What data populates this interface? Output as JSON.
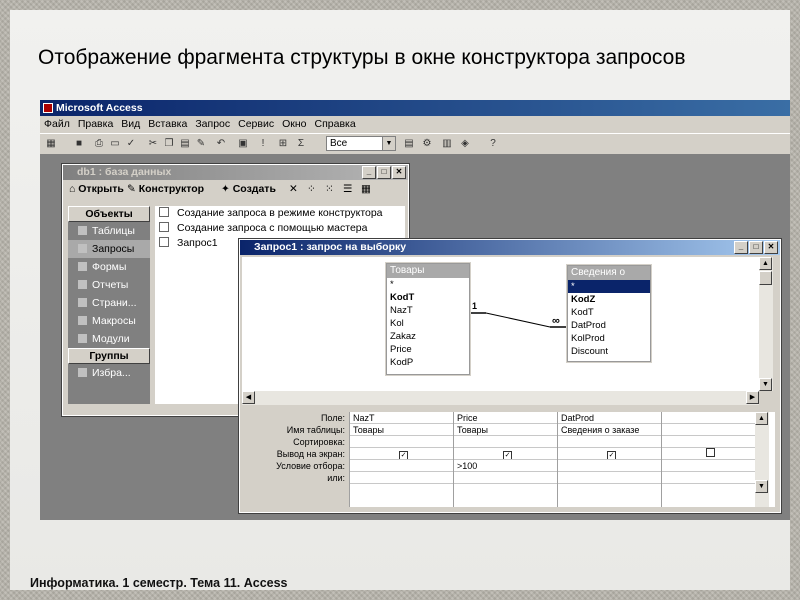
{
  "slide": {
    "title": "Отображение фрагмента структуры в окне конструктора запросов",
    "footer": "Информатика. 1 семестр. Тема 11. Access"
  },
  "app": {
    "title": "Microsoft Access",
    "menu": [
      "Файл",
      "Правка",
      "Вид",
      "Вставка",
      "Запрос",
      "Сервис",
      "Окно",
      "Справка"
    ],
    "toolbar_combo": "Все",
    "sigma": "Σ"
  },
  "db_window": {
    "title": "db1 : база данных",
    "actions": {
      "open": "Открыть",
      "designer": "Конструктор",
      "create": "Создать"
    },
    "objects_header": "Объекты",
    "objects": [
      "Таблицы",
      "Запросы",
      "Формы",
      "Отчеты",
      "Страни...",
      "Макросы",
      "Модули"
    ],
    "groups_header": "Группы",
    "groups": [
      "Избра..."
    ],
    "list": [
      "Создание запроса в режиме конструктора",
      "Создание запроса с помощью мастера",
      "Запрос1"
    ]
  },
  "query_window": {
    "title": "Запрос1 : запрос на выборку",
    "table1": {
      "name": "Товары",
      "fields": [
        "*",
        "KodT",
        "NazT",
        "Kol",
        "Zakaz",
        "Price",
        "KodP"
      ]
    },
    "table2": {
      "name": "Сведения о",
      "fields": [
        "*",
        "KodZ",
        "KodT",
        "DatProd",
        "KolProd",
        "Discount"
      ]
    },
    "relation": {
      "one": "1",
      "many": "∞"
    },
    "grid_labels": [
      "Поле:",
      "Имя таблицы:",
      "Сортировка:",
      "Вывод на экран:",
      "Условие отбора:",
      "или:"
    ],
    "grid_columns": [
      {
        "field": "NazT",
        "table": "Товары",
        "sort": "",
        "show": true,
        "criteria": "",
        "or": ""
      },
      {
        "field": "Price",
        "table": "Товары",
        "sort": "",
        "show": true,
        "criteria": ">100",
        "or": ""
      },
      {
        "field": "DatProd",
        "table": "Сведения о заказе",
        "sort": "",
        "show": true,
        "criteria": "",
        "or": ""
      },
      {
        "field": "",
        "table": "",
        "sort": "",
        "show": false,
        "criteria": "",
        "or": ""
      }
    ]
  }
}
